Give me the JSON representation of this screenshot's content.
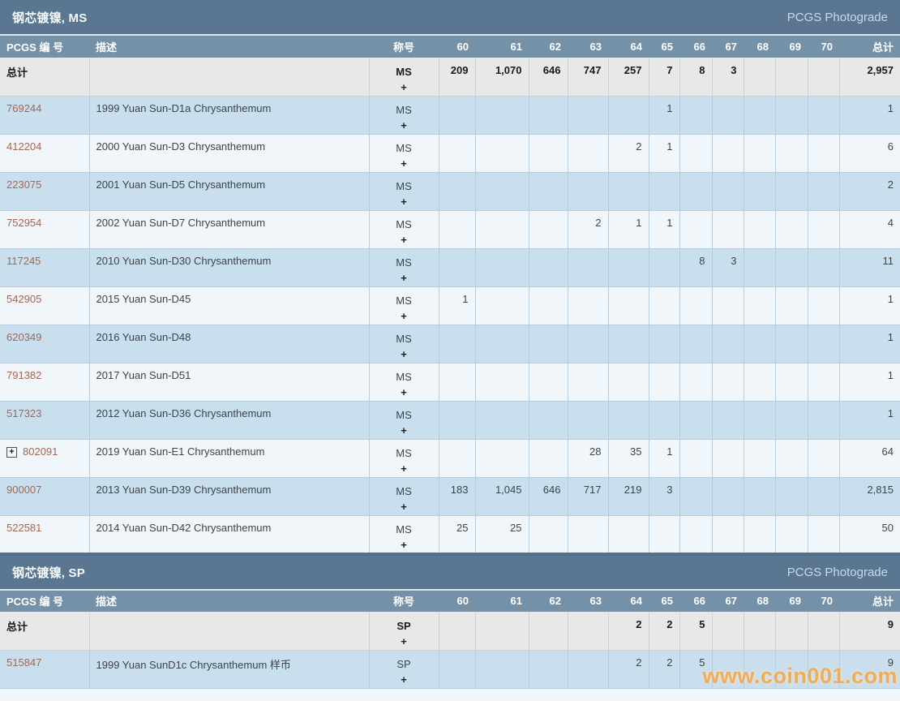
{
  "watermark": "www.coin001.com",
  "icons": {
    "expand": "+"
  },
  "grade_columns": [
    "60",
    "61",
    "62",
    "63",
    "64",
    "65",
    "66",
    "67",
    "68",
    "69",
    "70"
  ],
  "columns": {
    "pcgs": "PCGS 编 号",
    "desc": "描述",
    "designation": "称号",
    "total": "总计"
  },
  "colors": {
    "titlebar": "#5b7690",
    "column_header": "#7591a8",
    "row_blue": "#cadfee",
    "row_white": "#f1f6fa",
    "totals_bg": "#e8e8e6",
    "link": "#a2674f",
    "watermark_orange": "#f29d38"
  },
  "tables": [
    {
      "title": "钢芯镀镍, MS",
      "brand_link": "PCGS Photograde",
      "totals_row": {
        "label": "总计",
        "designation": "MS",
        "plus": "+",
        "grades": {
          "60": "209",
          "61": "1,070",
          "62": "646",
          "63": "747",
          "64": "257",
          "65": "7",
          "66": "8",
          "67": "3"
        },
        "total": "2,957"
      },
      "rows": [
        {
          "pcgs": "769244",
          "desc": "1999 Yuan Sun-D1a Chrysanthemum",
          "designation": "MS",
          "plus": "+",
          "grades": {
            "65": "1"
          },
          "total": "1"
        },
        {
          "pcgs": "412204",
          "desc": "2000 Yuan Sun-D3 Chrysanthemum",
          "designation": "MS",
          "plus": "+",
          "grades": {
            "64": "2",
            "65": "1"
          },
          "total": "6"
        },
        {
          "pcgs": "223075",
          "desc": "2001 Yuan Sun-D5 Chrysanthemum",
          "designation": "MS",
          "plus": "+",
          "grades": {},
          "total": "2"
        },
        {
          "pcgs": "752954",
          "desc": "2002 Yuan Sun-D7 Chrysanthemum",
          "designation": "MS",
          "plus": "+",
          "grades": {
            "63": "2",
            "64": "1",
            "65": "1"
          },
          "total": "4"
        },
        {
          "pcgs": "117245",
          "desc": "2010 Yuan Sun-D30 Chrysanthemum",
          "designation": "MS",
          "plus": "+",
          "grades": {
            "66": "8",
            "67": "3"
          },
          "total": "11"
        },
        {
          "pcgs": "542905",
          "desc": "2015 Yuan Sun-D45",
          "designation": "MS",
          "plus": "+",
          "grades": {
            "60": "1"
          },
          "total": "1"
        },
        {
          "pcgs": "620349",
          "desc": "2016 Yuan Sun-D48",
          "designation": "MS",
          "plus": "+",
          "grades": {},
          "total": "1"
        },
        {
          "pcgs": "791382",
          "desc": "2017 Yuan Sun-D51",
          "designation": "MS",
          "plus": "+",
          "grades": {},
          "total": "1"
        },
        {
          "pcgs": "517323",
          "desc": "2012 Yuan Sun-D36 Chrysanthemum",
          "designation": "MS",
          "plus": "+",
          "grades": {},
          "total": "1"
        },
        {
          "pcgs": "802091",
          "desc": "2019 Yuan Sun-E1 Chrysanthemum",
          "designation": "MS",
          "plus": "+",
          "expand_icon": true,
          "grades": {
            "63": "28",
            "64": "35",
            "65": "1"
          },
          "total": "64"
        },
        {
          "pcgs": "900007",
          "desc": "2013 Yuan Sun-D39 Chrysanthemum",
          "designation": "MS",
          "plus": "+",
          "grades": {
            "60": "183",
            "61": "1,045",
            "62": "646",
            "63": "717",
            "64": "219",
            "65": "3"
          },
          "total": "2,815"
        },
        {
          "pcgs": "522581",
          "desc": "2014 Yuan Sun-D42 Chrysanthemum",
          "designation": "MS",
          "plus": "+",
          "grades": {
            "60": "25",
            "61": "25"
          },
          "total": "50"
        }
      ]
    },
    {
      "title": "钢芯镀镍, SP",
      "brand_link": "PCGS Photograde",
      "totals_row": {
        "label": "总计",
        "designation": "SP",
        "plus": "+",
        "grades": {
          "64": "2",
          "65": "2",
          "66": "5"
        },
        "total": "9"
      },
      "rows": [
        {
          "pcgs": "515847",
          "desc": "1999 Yuan SunD1c Chrysanthemum 样币",
          "designation": "SP",
          "plus": "+",
          "grades": {
            "64": "2",
            "65": "2",
            "66": "5"
          },
          "total": "9"
        }
      ]
    }
  ]
}
